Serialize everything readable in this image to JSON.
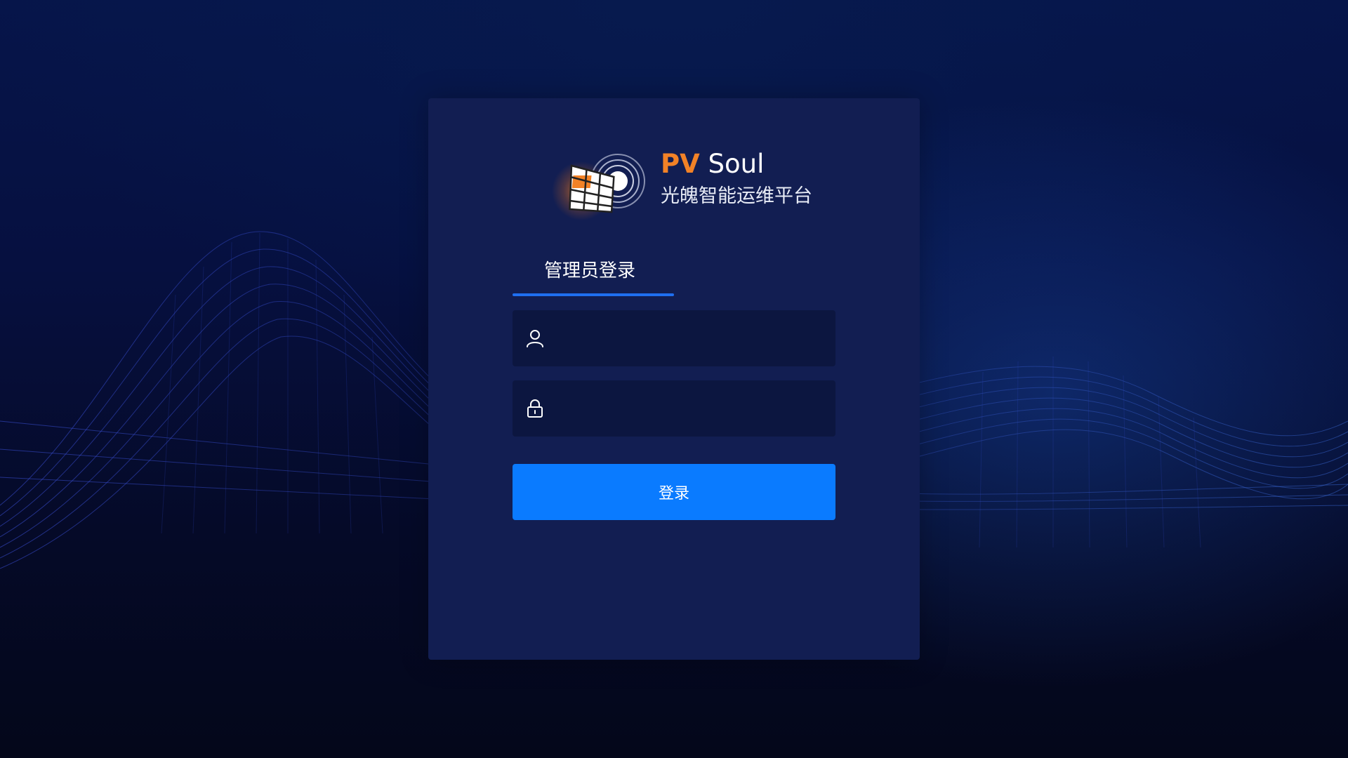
{
  "brand": {
    "name_accent": "PV",
    "name_rest": "Soul",
    "subtitle": "光魄智能运维平台",
    "logo_icon": "solar-panel-signal-icon",
    "accent_color": "#f28227"
  },
  "login": {
    "tab_label": "管理员登录",
    "username": {
      "icon": "user-icon",
      "value": "",
      "placeholder": ""
    },
    "password": {
      "icon": "lock-icon",
      "value": "",
      "placeholder": ""
    },
    "submit_label": "登录",
    "primary_color": "#0a7bff"
  }
}
